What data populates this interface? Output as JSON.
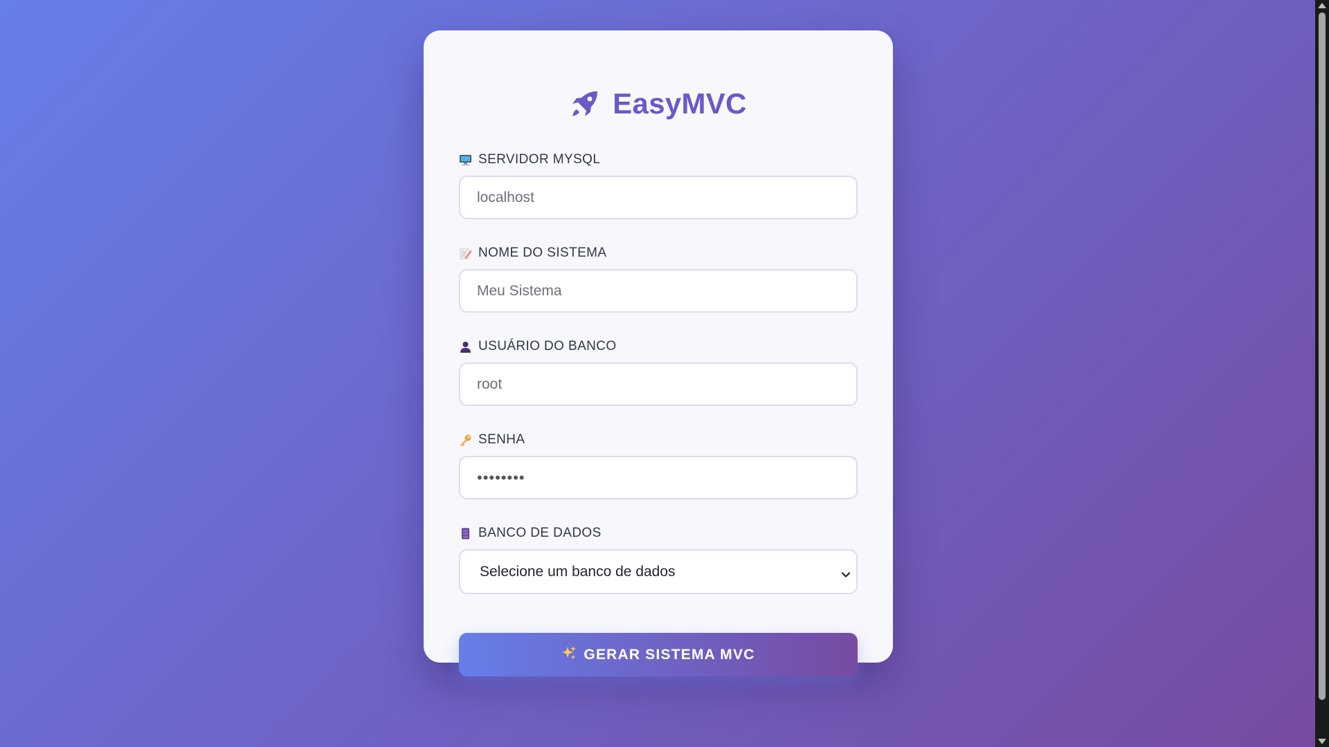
{
  "app": {
    "title": "EasyMVC",
    "brand_icon": "rocket-icon",
    "brand_color": "#6a5ac6"
  },
  "form": {
    "server": {
      "label": "SERVIDOR MYSQL",
      "icon": "computer-icon",
      "value": "",
      "placeholder": "localhost"
    },
    "system_name": {
      "label": "NOME DO SISTEMA",
      "icon": "memo-icon",
      "value": "",
      "placeholder": "Meu Sistema"
    },
    "db_user": {
      "label": "USUÁRIO DO BANCO",
      "icon": "user-icon",
      "value": "",
      "placeholder": "root"
    },
    "password": {
      "label": "SENHA",
      "icon": "key-icon",
      "value": "••••••••"
    },
    "database": {
      "label": "BANCO DE DADOS",
      "icon": "database-icon",
      "selected": "Selecione um banco de dados"
    },
    "submit": {
      "label": "GERAR SISTEMA MVC",
      "icon": "sparkles-icon"
    }
  },
  "colors": {
    "gradient_start": "#667eea",
    "gradient_end": "#764ba2",
    "card_bg": "#f7f7fc"
  }
}
